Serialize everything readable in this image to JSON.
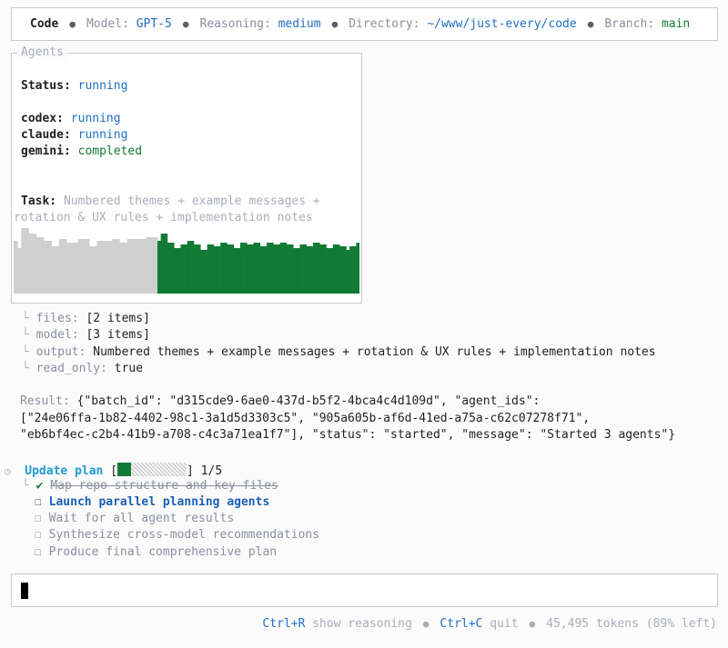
{
  "header": {
    "app": "Code",
    "model_label": "Model:",
    "model_value": "GPT-5",
    "reasoning_label": "Reasoning:",
    "reasoning_value": "medium",
    "directory_label": "Directory:",
    "directory_value": "~/www/just-every/code",
    "branch_label": "Branch:",
    "branch_value": "main"
  },
  "agents": {
    "legend": "Agents",
    "status_label": "Status:",
    "status_value": "running",
    "list": [
      {
        "name": "codex:",
        "state": "running",
        "color": "#1f6fc2"
      },
      {
        "name": "claude:",
        "state": "running",
        "color": "#1f6fc2"
      },
      {
        "name": "gemini:",
        "state": "completed",
        "color": "#117a34"
      }
    ],
    "task_label": "Task:",
    "task_line1": "Numbered themes + example messages +",
    "task_line2": "rotation & UX rules + implementation notes",
    "activity_colors": {
      "done": "#117a34",
      "pending": "#cfcfcf"
    }
  },
  "details": [
    {
      "key": "files:",
      "value": "[2 items]"
    },
    {
      "key": "model:",
      "value": "[3 items]"
    },
    {
      "key": "output:",
      "value": "Numbered themes + example messages + rotation & UX rules + implementation notes"
    },
    {
      "key": "read_only:",
      "value": "true"
    }
  ],
  "result": {
    "label": "Result:",
    "line1": "{\"batch_id\": \"d315cde9-6ae0-437d-b5f2-4bca4c4d109d\", \"agent_ids\":",
    "line2": "[\"24e06ffa-1b82-4402-98c1-3a1d5d3303c5\", \"905a605b-af6d-41ed-a75a-c62c07278f71\",",
    "line3": "\"eb6bf4ec-c2b4-41b9-a708-c4c3a71ea1f7\"], \"status\": \"started\", \"message\": \"Started 3 agents\"}"
  },
  "plan": {
    "title": "Update plan",
    "bracket_open": "[",
    "bracket_close": "]",
    "progress_text": "1/5",
    "progress_fraction": 0.2,
    "items": [
      {
        "text": "Map repo structure and key files",
        "state": "done",
        "mark": "✔"
      },
      {
        "text": "Launch parallel planning agents",
        "state": "active",
        "mark": "☐"
      },
      {
        "text": "Wait for all agent results",
        "state": "pending",
        "mark": "☐"
      },
      {
        "text": "Synthesize cross-model recommendations",
        "state": "pending",
        "mark": "☐"
      },
      {
        "text": "Produce final comprehensive plan",
        "state": "pending",
        "mark": "☐"
      }
    ]
  },
  "footer": {
    "key1": "Ctrl+R",
    "text1": "show reasoning",
    "key2": "Ctrl+C",
    "text2": "quit",
    "tokens": "45,495 tokens (89% left)"
  }
}
